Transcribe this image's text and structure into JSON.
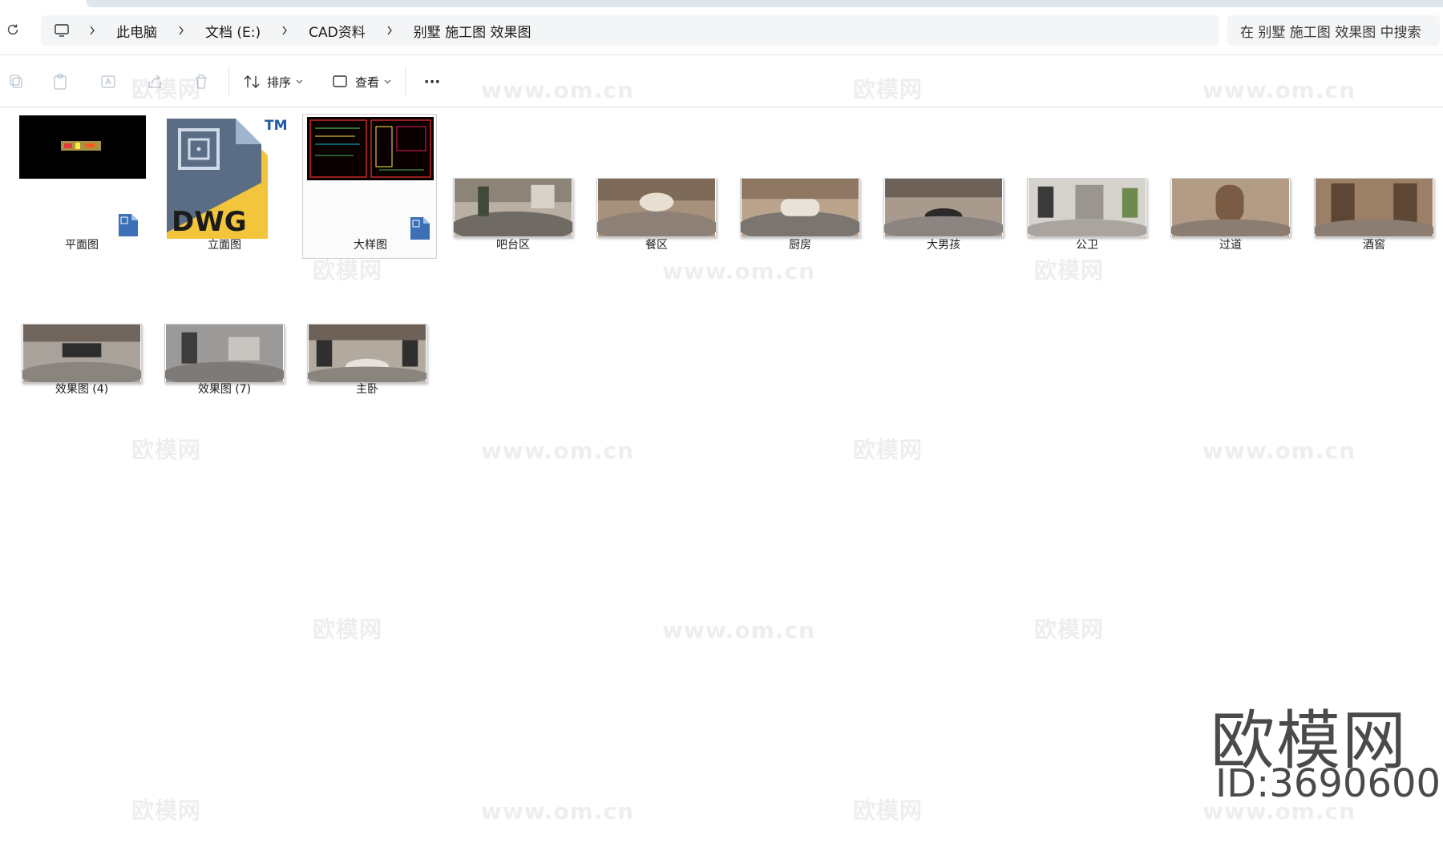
{
  "breadcrumb": {
    "items": [
      "此电脑",
      "文档 (E:)",
      "CAD资料",
      "别墅 施工图 效果图"
    ]
  },
  "search": {
    "placeholder": "在 别墅 施工图 效果图 中搜索"
  },
  "toolbar": {
    "sort_label": "排序",
    "view_label": "查看",
    "more_label": "···"
  },
  "files_row1": [
    {
      "name": "平面图",
      "kind": "cad-black"
    },
    {
      "name": "立面图",
      "kind": "dwg-icon"
    },
    {
      "name": "大样图",
      "kind": "cad-red",
      "selected": true
    },
    {
      "name": "吧台区",
      "kind": "pano"
    },
    {
      "name": "餐区",
      "kind": "pano"
    },
    {
      "name": "厨房",
      "kind": "pano"
    },
    {
      "name": "大男孩",
      "kind": "pano"
    },
    {
      "name": "公卫",
      "kind": "pano"
    },
    {
      "name": "过道",
      "kind": "pano"
    },
    {
      "name": "酒窖",
      "kind": "pano"
    }
  ],
  "files_row2": [
    {
      "name": "效果图 (4)",
      "kind": "pano"
    },
    {
      "name": "效果图 (7)",
      "kind": "pano"
    },
    {
      "name": "主卧",
      "kind": "pano"
    }
  ],
  "dwg": {
    "text": "DWG",
    "tm": "TM"
  },
  "watermark": {
    "logo_text": "欧模网",
    "url_text": "www.om.cn",
    "id_text": "ID:3690600"
  },
  "colors": {
    "accent": "#005fb8",
    "dwg_yellow": "#f4c430",
    "dwg_blue": "#5a6d86"
  }
}
